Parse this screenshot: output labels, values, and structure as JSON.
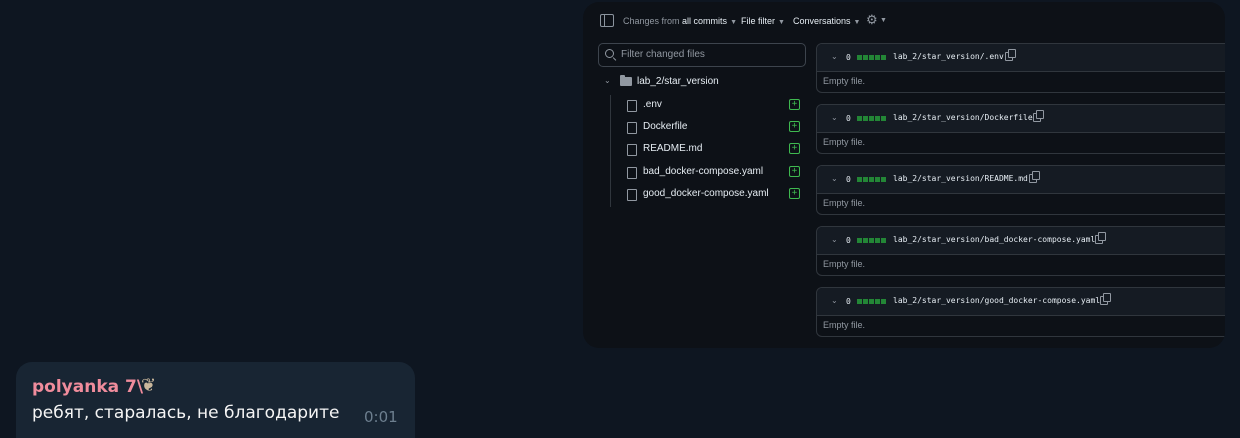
{
  "screenshot": {
    "toolbar": {
      "changes_prefix": "Changes from",
      "changes_value": "all commits",
      "file_filter": "File filter",
      "conversations": "Conversations"
    },
    "filter": {
      "placeholder": "Filter changed files"
    },
    "folder": "lab_2/star_version",
    "files": [
      ".env",
      "Dockerfile",
      "README.md",
      "bad_docker-compose.yaml",
      "good_docker-compose.yaml"
    ],
    "diffs": [
      {
        "count": "0",
        "path": "lab_2/star_version/.env",
        "note": "Empty file."
      },
      {
        "count": "0",
        "path": "lab_2/star_version/Dockerfile",
        "note": "Empty file."
      },
      {
        "count": "0",
        "path": "lab_2/star_version/README.md",
        "note": "Empty file."
      },
      {
        "count": "0",
        "path": "lab_2/star_version/bad_docker-compose.yaml",
        "note": "Empty file."
      },
      {
        "count": "0",
        "path": "lab_2/star_version/good_docker-compose.yaml",
        "note": "Empty file."
      }
    ]
  },
  "message": {
    "sender": "polyanka 7\\",
    "text": "ребят, старалась, не благодарите",
    "time": "0:01"
  },
  "colors": {
    "chat_background": "#0e1621",
    "bubble": "#182533",
    "sender_name": "#f08c9c",
    "github_background": "#0d1117",
    "added_green": "#3fb950"
  },
  "icons": [
    "sidebar-toggle-icon",
    "chevron-down-icon",
    "gear-icon",
    "search-icon",
    "folder-icon",
    "file-icon",
    "file-added-icon",
    "copy-icon",
    "maple-leaf-icon"
  ]
}
